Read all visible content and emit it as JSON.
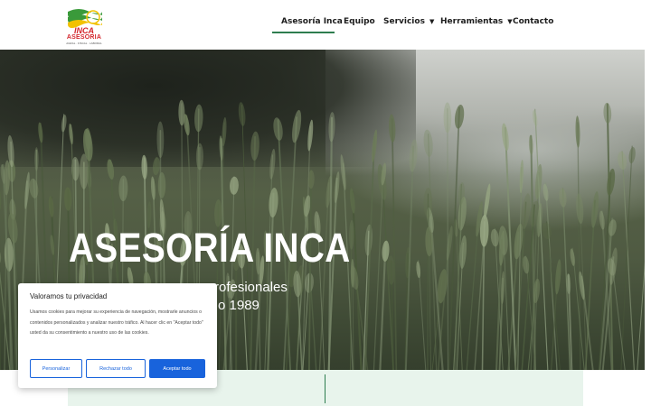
{
  "header": {
    "logo": {
      "wordmark": "INCA",
      "name": "ASESORIA",
      "tagline": "AGRAL · FISCAL · LABORAL",
      "colors": {
        "green": "#3a9a3a",
        "yellow": "#f2c200",
        "red": "#d4272d"
      }
    },
    "nav": [
      {
        "label": "Asesoría Inca",
        "active": true
      },
      {
        "label": "Equipo",
        "active": false
      },
      {
        "label": "Servicios",
        "active": false,
        "has_dropdown": true
      },
      {
        "label": "Herramientas",
        "active": false,
        "has_dropdown": true
      },
      {
        "label": "Contacto",
        "active": false
      }
    ],
    "caret_icon": "▼"
  },
  "hero": {
    "title": "ASESORÍA INCA",
    "subtitle_line1": "rofesionales",
    "subtitle_line2": "o 1989"
  },
  "cookie_banner": {
    "title": "Valoramos tu privacidad",
    "text": "Usamos cookies para mejorar su experiencia de navegación, mostrarle anuncios o contenidos personalizados y analizar nuestro tráfico. Al hacer clic en \"Aceptar todo\" usted da su consentimiento a nuestro uso de las cookies.",
    "buttons": {
      "customize": "Personalizar",
      "reject": "Rechazar todo",
      "accept": "Aceptar todo"
    }
  },
  "colors": {
    "accent_green": "#2e7d4f",
    "cookie_blue": "#1863dc",
    "strip_bg": "#e8f4ec"
  }
}
